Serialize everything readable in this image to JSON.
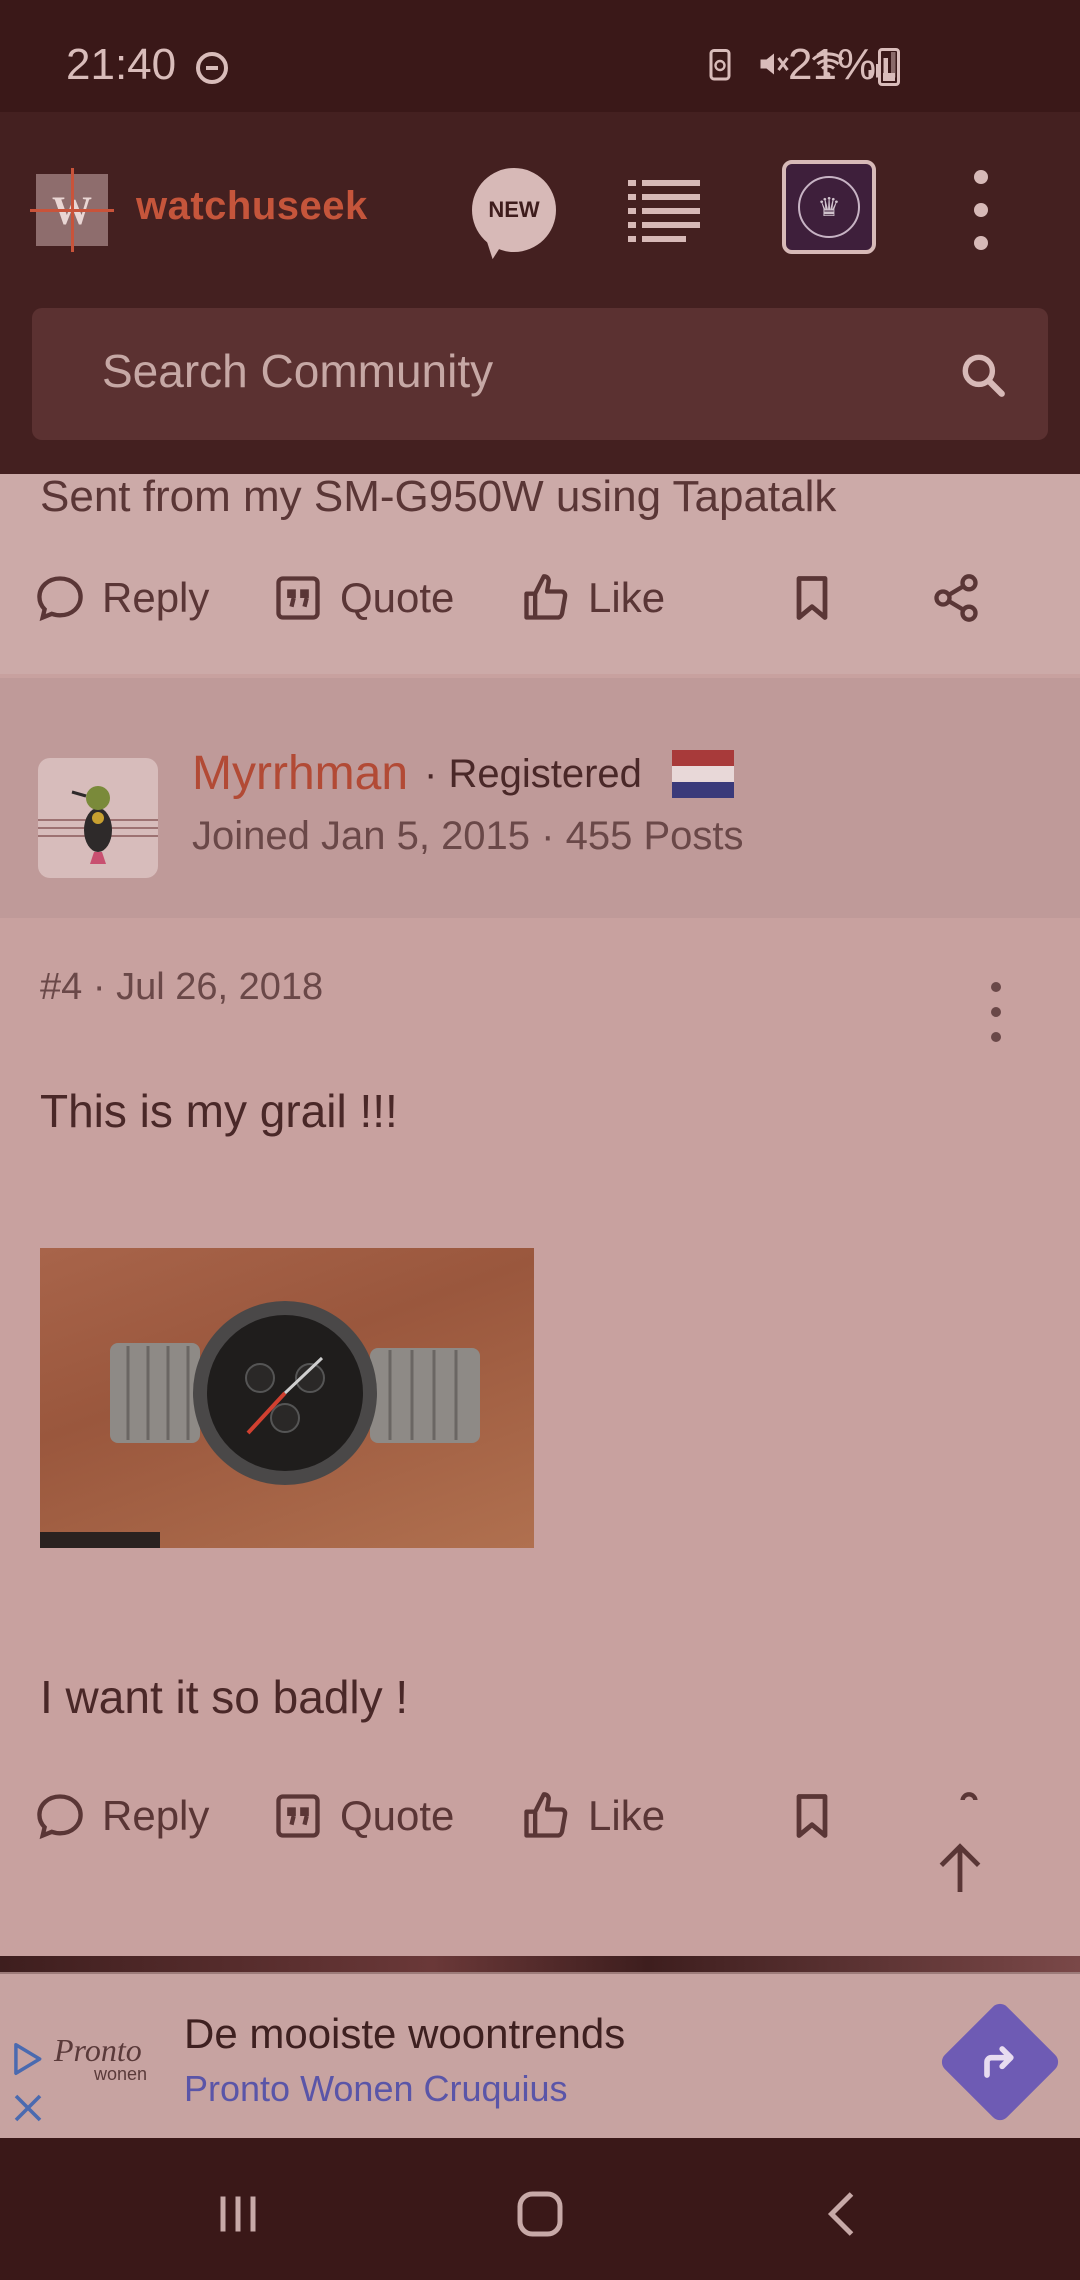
{
  "status_bar": {
    "time": "21:40",
    "battery": "21%"
  },
  "header": {
    "logo_letter": "W",
    "site_name": "watchuseek",
    "new_label": "NEW",
    "search": {
      "placeholder": "Search Community"
    }
  },
  "previous_post": {
    "signature": "Sent from my SM-G950W using Tapatalk",
    "actions": {
      "reply": "Reply",
      "quote": "Quote",
      "like": "Like"
    }
  },
  "post": {
    "author": {
      "name": "Myrrhman",
      "role": "Registered",
      "meta": "Joined Jan 5, 2015 · 455 Posts"
    },
    "number": "#4",
    "date": "Jul 26, 2018",
    "line1": "This is my grail !!!",
    "line2": "I want it so badly !",
    "actions": {
      "reply": "Reply",
      "quote": "Quote",
      "like": "Like"
    }
  },
  "ad": {
    "brand": "Pronto",
    "brand_sub": "wonen",
    "title": "De mooiste woontrends",
    "subtitle": "Pronto Wonen Cruquius"
  },
  "colors": {
    "accent": "#c5553b",
    "header_bg": "#442020",
    "ad_cta": "#6e5bb4"
  }
}
